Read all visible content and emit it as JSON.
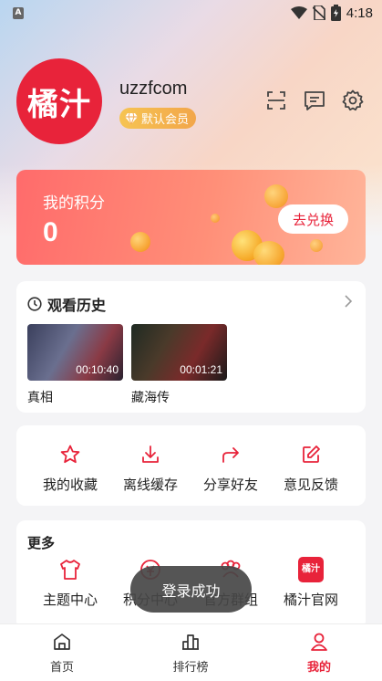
{
  "status_bar": {
    "time": "4:18",
    "app_badge": "A"
  },
  "profile": {
    "avatar_text": "橘汁",
    "username": "uzzfcom",
    "member_badge": "默认会员"
  },
  "points": {
    "title": "我的积分",
    "value": "0",
    "redeem_label": "去兑换"
  },
  "history": {
    "title": "观看历史",
    "items": [
      {
        "title": "真相",
        "duration": "00:10:40"
      },
      {
        "title": "藏海传",
        "duration": "00:01:21"
      }
    ]
  },
  "actions": [
    {
      "label": "我的收藏",
      "icon": "star-icon"
    },
    {
      "label": "离线缓存",
      "icon": "download-icon"
    },
    {
      "label": "分享好友",
      "icon": "share-icon"
    },
    {
      "label": "意见反馈",
      "icon": "feedback-edit-icon"
    }
  ],
  "more": {
    "title": "更多",
    "items": [
      {
        "label": "主题中心",
        "icon": "shirt-icon"
      },
      {
        "label": "积分中心",
        "icon": "points-icon"
      },
      {
        "label": "官方群组",
        "icon": "group-icon"
      },
      {
        "label": "橘汁官网",
        "icon": "logo-icon",
        "icon_text": "橘汁"
      }
    ]
  },
  "toast": "登录成功",
  "tabs": [
    {
      "label": "首页",
      "icon": "home-icon"
    },
    {
      "label": "排行榜",
      "icon": "ranking-icon"
    },
    {
      "label": "我的",
      "icon": "profile-icon",
      "active": true
    }
  ],
  "colors": {
    "accent": "#e8233a",
    "points_card": "#ff7a6e",
    "badge": "#f2a64a"
  }
}
